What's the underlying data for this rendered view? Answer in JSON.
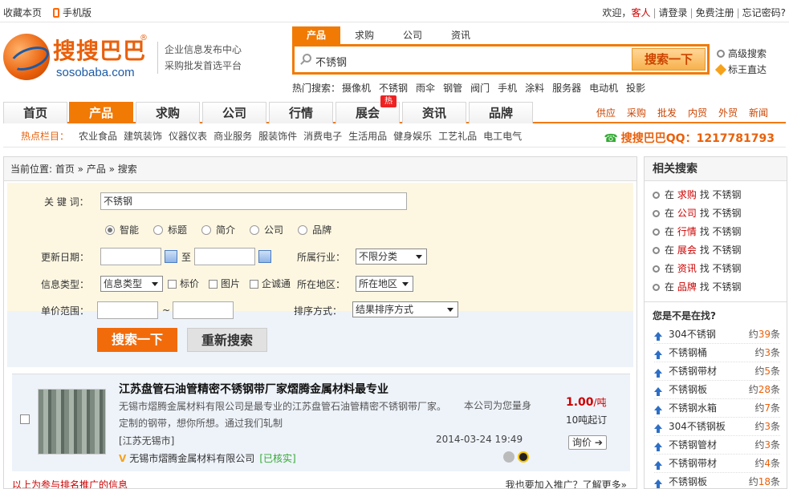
{
  "topbar": {
    "bookmark": "收藏本页",
    "mobile": "手机版",
    "welcome": "欢迎，",
    "guest": "客人",
    "login": "请登录",
    "register": "免费注册",
    "forgot": "忘记密码?"
  },
  "logo": {
    "cn": "搜搜巴巴",
    "en": "sosobaba.com",
    "reg": "®"
  },
  "slogan": {
    "line1": "企业信息发布中心",
    "line2": "采购批发首选平台"
  },
  "search": {
    "tabs": [
      "产品",
      "求购",
      "公司",
      "资讯"
    ],
    "active_tab": "产品",
    "query": "不锈钢",
    "button": "搜索一下",
    "advanced": "高级搜索",
    "direct": "标王直达"
  },
  "hot_search": {
    "label": "热门搜索：",
    "items": [
      "摄像机",
      "不锈钢",
      "雨伞",
      "钢管",
      "阀门",
      "手机",
      "涂料",
      "服务器",
      "电动机",
      "投影"
    ]
  },
  "nav": {
    "items": [
      "首页",
      "产品",
      "求购",
      "公司",
      "行情",
      "展会",
      "资讯",
      "品牌"
    ],
    "active": "产品",
    "hot_badge": "热",
    "right": [
      "供应",
      "采购",
      "批发",
      "内贸",
      "外贸",
      "新闻"
    ]
  },
  "hot_columns": {
    "label": "热点栏目：",
    "items": [
      "农业食品",
      "建筑装饰",
      "仪器仪表",
      "商业服务",
      "服装饰件",
      "消费电子",
      "生活用品",
      "健身娱乐",
      "工艺礼品",
      "电工电气"
    ],
    "qq": "搜搜巴巴QQ：1217781793"
  },
  "breadcrumb": "当前位置: 首页 » 产品 » 搜索",
  "form": {
    "keyword_label": "关 键 词：",
    "keyword_value": "不锈钢",
    "radios": [
      "智能",
      "标题",
      "简介",
      "公司",
      "品牌"
    ],
    "radio_selected": "智能",
    "date_label": "更新日期：",
    "date_to": "至",
    "industry_label": "所属行业：",
    "industry_value": "不限分类",
    "type_label": "信息类型：",
    "type_value": "信息类型",
    "checks": [
      "标价",
      "图片",
      "企诚通"
    ],
    "region_label": "所在地区：",
    "region_value": "所在地区",
    "price_label": "单价范围：",
    "price_sep": "~",
    "sort_label": "排序方式：",
    "sort_value": "结果排序方式",
    "search_btn": "搜索一下",
    "reset_btn": "重新搜索"
  },
  "result": {
    "title": "江苏盘管石油管精密不锈钢带厂家熠腾金属材料最专业",
    "desc": "无锡市熠腾金属材料有限公司是最专业的江苏盘管石油管精密不锈钢带厂家。 定制的钢带，想你所想。通过我们轧制",
    "desc2": "本公司为您量身",
    "price": "1.00",
    "unit": "/吨",
    "moq": "10吨起订",
    "location": "[江苏无锡市]",
    "date": "2014-03-24 19:49",
    "inquiry": "询价",
    "company": "无锡市熠腾金属材料有限公司",
    "verified": "[已核实]"
  },
  "footer_note": {
    "left": "以上为参与排名推广的信息",
    "right": "我也要加入推广？了解更多»"
  },
  "sidebar": {
    "title": "相关搜索",
    "related": [
      {
        "pre": "在",
        "k": "求购",
        "post": "找 不锈钢"
      },
      {
        "pre": "在",
        "k": "公司",
        "post": "找 不锈钢"
      },
      {
        "pre": "在",
        "k": "行情",
        "post": "找 不锈钢"
      },
      {
        "pre": "在",
        "k": "展会",
        "post": "找 不锈钢"
      },
      {
        "pre": "在",
        "k": "资讯",
        "post": "找 不锈钢"
      },
      {
        "pre": "在",
        "k": "品牌",
        "post": "找 不锈钢"
      }
    ],
    "question": "您是不是在找?",
    "suggest": [
      {
        "name": "304不锈钢",
        "count": "39"
      },
      {
        "name": "不锈钢桶",
        "count": "3"
      },
      {
        "name": "不锈钢带材",
        "count": "5"
      },
      {
        "name": "不锈钢板",
        "count": "28"
      },
      {
        "name": "不锈钢水箱",
        "count": "7"
      },
      {
        "name": "304不锈钢板",
        "count": "3"
      },
      {
        "name": "不锈钢管材",
        "count": "3"
      },
      {
        "name": "不锈钢带材",
        "count": "4"
      },
      {
        "name": "不锈钢板",
        "count": "18"
      }
    ],
    "prefix": "约",
    "suffix": "条"
  }
}
